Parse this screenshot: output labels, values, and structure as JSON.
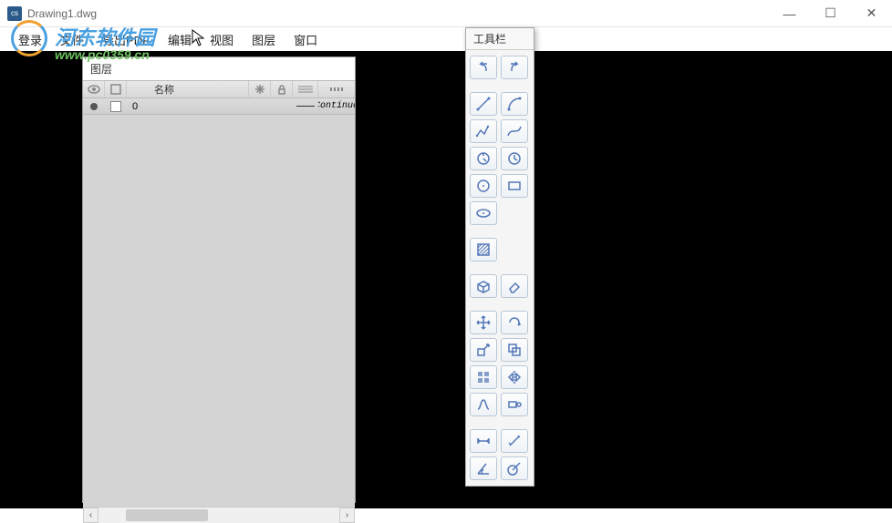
{
  "titlebar": {
    "app_icon_text": "cs",
    "title": "Drawing1.dwg"
  },
  "menu": {
    "items": [
      "登录",
      "文件",
      "导出PDF",
      "编辑",
      "视图",
      "图层",
      "窗口"
    ]
  },
  "layers_panel": {
    "title": "图层",
    "header": {
      "name_label": "名称"
    },
    "rows": [
      {
        "name": "0",
        "linetype": "Continuo"
      }
    ]
  },
  "toolbox": {
    "title": "工具栏",
    "tools": [
      [
        "undo-icon",
        "redo-icon"
      ],
      [
        "line-icon",
        "arc-icon"
      ],
      [
        "polyline-icon",
        "spline-icon"
      ],
      [
        "compass-icon",
        "clock-icon"
      ],
      [
        "circle-icon",
        "rect-icon"
      ],
      [
        "ellipse-icon"
      ],
      [
        "hatch-icon"
      ],
      [
        "box3d-icon",
        "eraser-icon"
      ],
      [
        "move-icon",
        "rotate-icon"
      ],
      [
        "scale-icon",
        "offset-icon"
      ],
      [
        "array-icon",
        "mirror-icon"
      ],
      [
        "trim-icon",
        "extend-icon"
      ],
      [
        "dim-linear-icon",
        "dim-aligned-icon"
      ],
      [
        "dim-angular-icon",
        "dim-radius-icon"
      ]
    ]
  },
  "watermark": {
    "line1": "河东软件园",
    "line2": "www.pc0359.cn"
  }
}
